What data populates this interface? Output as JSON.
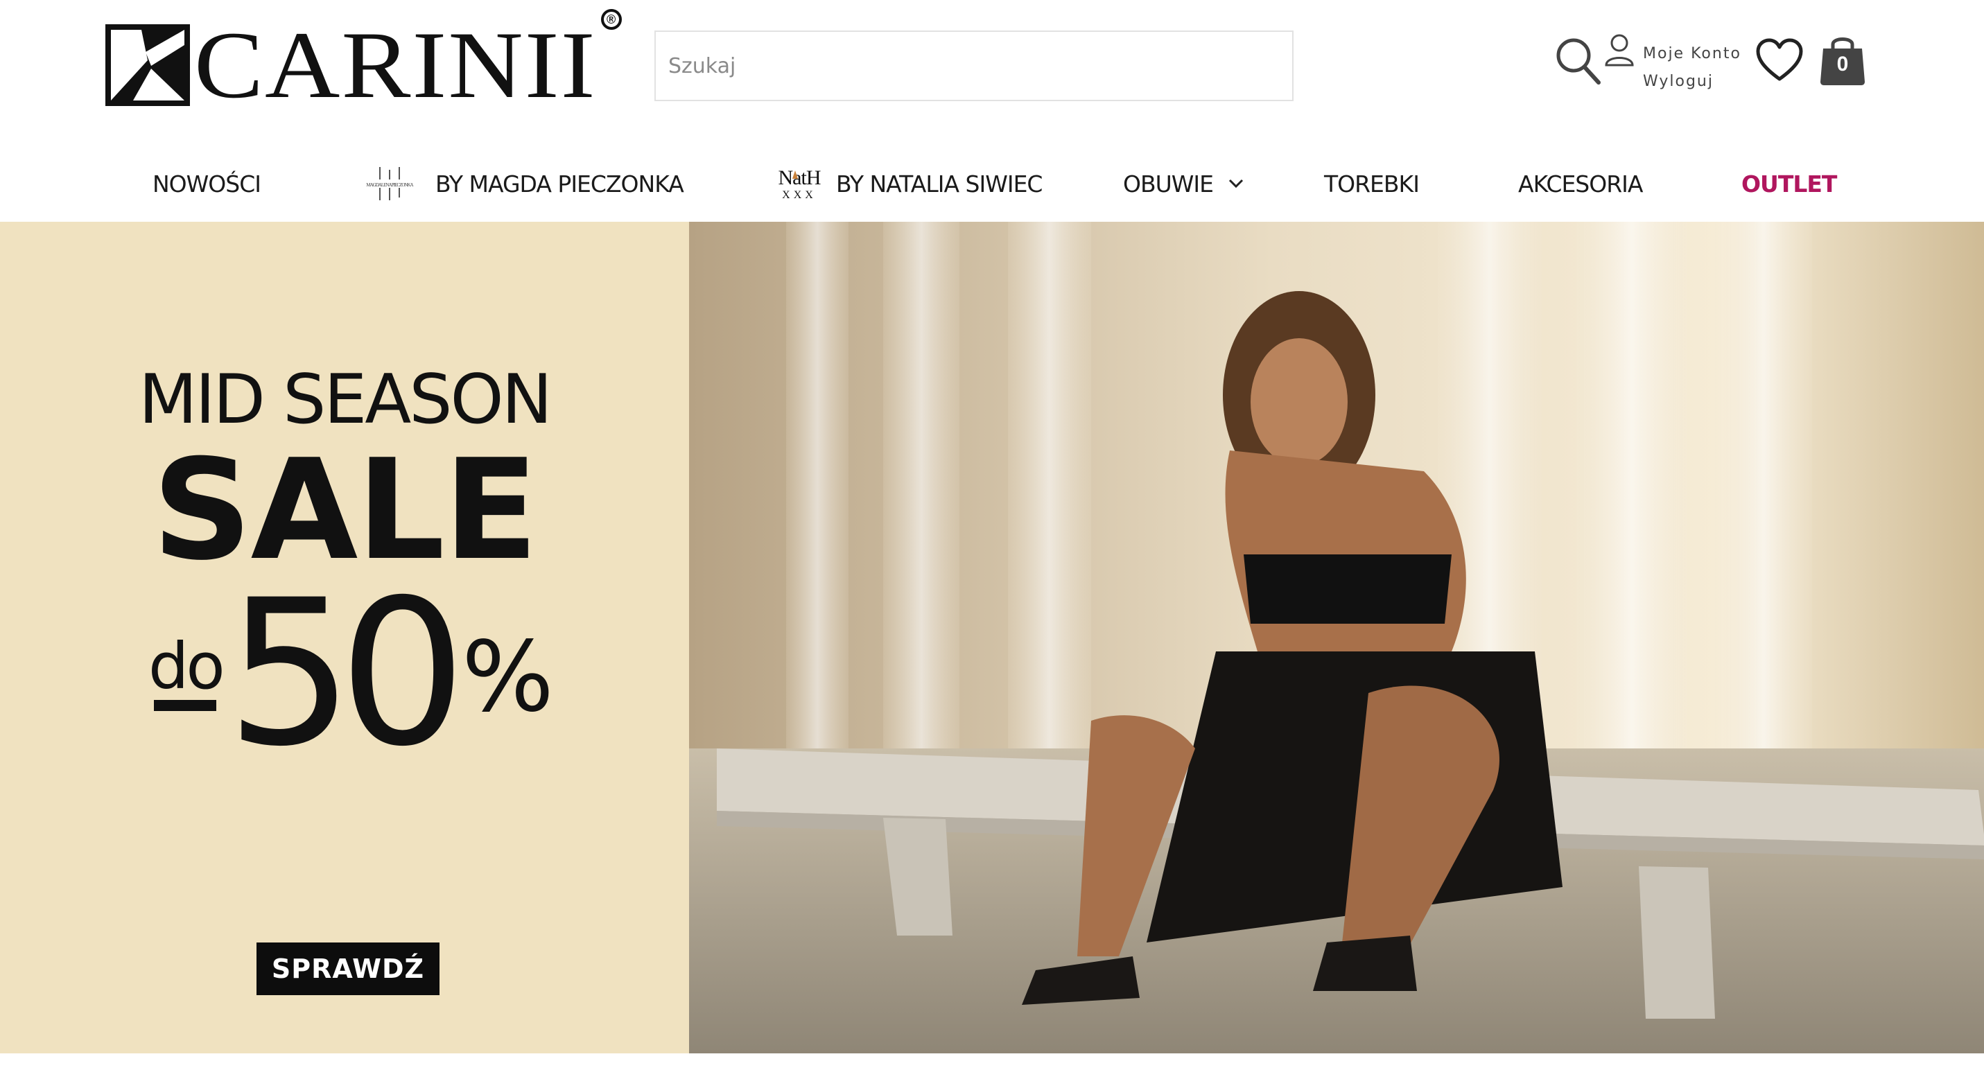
{
  "header": {
    "logo_text": "CARINII",
    "logo_registered": "®",
    "search_placeholder": "Szukaj",
    "account": {
      "my_account": "Moje Konto",
      "logout": "Wyloguj"
    },
    "cart_count": "0"
  },
  "nav": {
    "items": [
      {
        "label": "NOWOŚCI"
      },
      {
        "label": "BY MAGDA PIECZONKA",
        "brand_mark": "MAGDALENA PIECZONKA"
      },
      {
        "label": "BY NATALIA SIWIEC",
        "brand_mark_top": "NatH",
        "brand_mark_bottom": "XXX"
      },
      {
        "label": "OBUWIE"
      },
      {
        "label": "TOREBKI"
      },
      {
        "label": "AKCESORIA"
      },
      {
        "label": "OUTLET"
      }
    ],
    "outlet_color": "#b0165e"
  },
  "hero": {
    "line1": "MID SEASON",
    "line2": "SALE",
    "prefix": "do",
    "amount": "50",
    "percent": "%",
    "cta": "SPRAWDŹ",
    "promo_bg": "#f0e2c0"
  },
  "icons": {
    "search": "search-icon",
    "user": "user-icon",
    "wishlist": "heart-icon",
    "cart": "shopping-bag-icon",
    "dropdown": "chevron-down-icon"
  }
}
